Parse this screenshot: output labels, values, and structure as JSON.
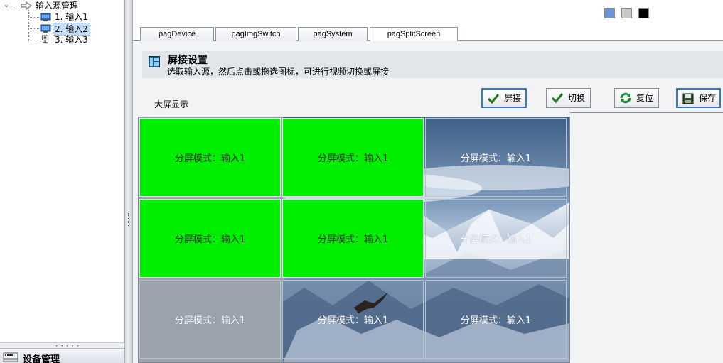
{
  "tree": {
    "root_label": "输入源管理",
    "items": [
      {
        "label": "1. 输入1",
        "selected": false
      },
      {
        "label": "2. 输入2",
        "selected": true
      },
      {
        "label": "3. 输入3",
        "selected": false
      }
    ]
  },
  "bottom_panel": {
    "device_label": "设备管理"
  },
  "theme_swatches": [
    "#6c94d4",
    "#c8c8c8",
    "#000000"
  ],
  "tabs": [
    {
      "label": "pagDevice",
      "active": false
    },
    {
      "label": "pagImgSwitch",
      "active": false
    },
    {
      "label": "pagSystem",
      "active": false
    },
    {
      "label": "pagSplitScreen",
      "active": true
    }
  ],
  "header": {
    "title": "屏接设置",
    "subtitle": "选取输入源，然后点击或拖选图标，可进行视频切换或屏接"
  },
  "screen_label": "大屏显示",
  "toolbar": {
    "splice_label": "屏接",
    "switch_label": "切换",
    "reset_label": "复位",
    "save_label": "保存"
  },
  "wall": {
    "rows": 3,
    "cols": 3,
    "cells": [
      {
        "label": "分屏模式：输入1",
        "fill": "green"
      },
      {
        "label": "分屏模式：输入1",
        "fill": "green"
      },
      {
        "label": "分屏模式：输入1",
        "fill": "photo"
      },
      {
        "label": "分屏模式：输入1",
        "fill": "green"
      },
      {
        "label": "分屏模式：输入1",
        "fill": "green"
      },
      {
        "label": "分屏模式：输入1",
        "fill": "photo"
      },
      {
        "label": "分屏模式：输入1",
        "fill": "photo"
      },
      {
        "label": "分屏模式：输入1",
        "fill": "photo"
      },
      {
        "label": "分屏模式：输入1",
        "fill": "photo"
      }
    ]
  },
  "colors": {
    "green_fill": "#00ee00",
    "header_bg": "#e2e5ea",
    "accent_blue": "#3b78c7"
  }
}
